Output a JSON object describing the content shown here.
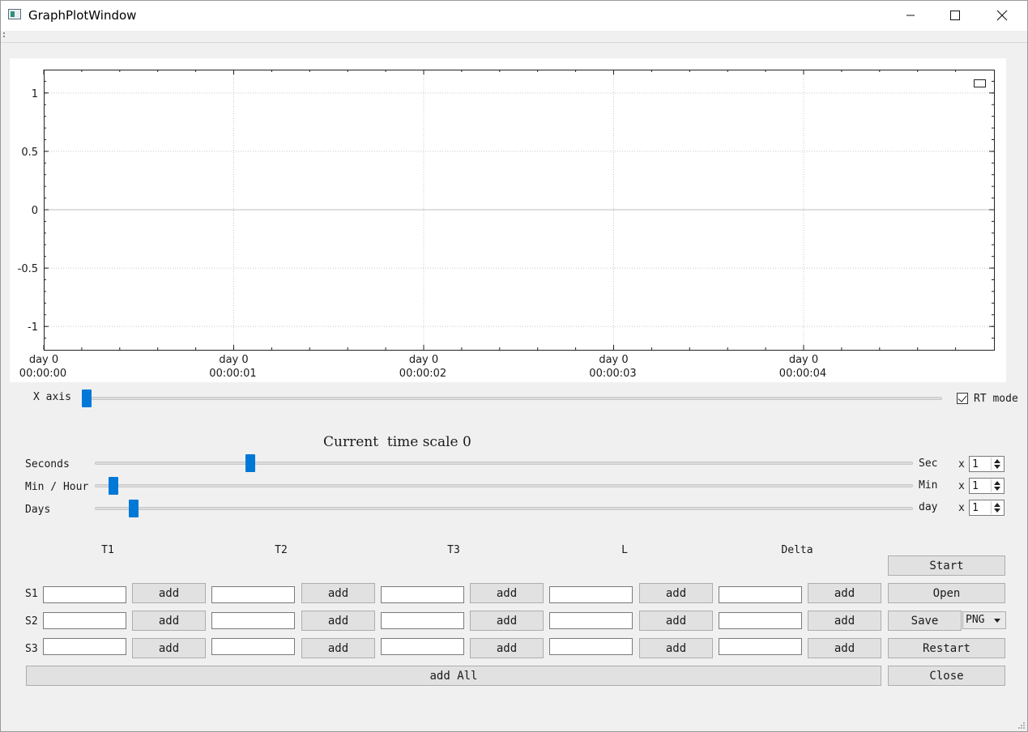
{
  "window": {
    "title": "GraphPlotWindow"
  },
  "chart_data": {
    "type": "line",
    "title": "",
    "xlabel": "",
    "ylabel": "",
    "x_tick_labels": [
      {
        "line1": "day 0",
        "line2": "00:00:00"
      },
      {
        "line1": "day 0",
        "line2": "00:00:01"
      },
      {
        "line1": "day 0",
        "line2": "00:00:02"
      },
      {
        "line1": "day 0",
        "line2": "00:00:03"
      },
      {
        "line1": "day 0",
        "line2": "00:00:04"
      }
    ],
    "y_tick_labels": [
      "1",
      "0.5",
      "0",
      "-0.5",
      "-1"
    ],
    "ylim": [
      -1.2,
      1.2
    ],
    "grid": true,
    "legend": "top-right",
    "series": []
  },
  "xaxis_slider": {
    "label": "X axis",
    "value": 0
  },
  "rt_mode": {
    "label": "RT mode",
    "checked": true
  },
  "time_scale": {
    "text": "Current  time scale",
    "value": "0"
  },
  "sliders": [
    {
      "label": "Seconds",
      "unit": "Sec",
      "mult_label": "x",
      "mult_value": "1",
      "fraction": 0.19
    },
    {
      "label": "Min / Hour",
      "unit": "Min",
      "mult_label": "x",
      "mult_value": "1",
      "fraction": 0.02
    },
    {
      "label": "Days",
      "unit": "day",
      "mult_label": "x",
      "mult_value": "1",
      "fraction": 0.045
    }
  ],
  "columns": [
    "T1",
    "T2",
    "T3",
    "L",
    "Delta"
  ],
  "rows": [
    "S1",
    "S2",
    "S3"
  ],
  "add_label": "add",
  "add_all_label": "add All",
  "actions": {
    "start": "Start",
    "open": "Open",
    "save": "Save",
    "format": "PNG",
    "restart": "Restart",
    "close": "Close"
  },
  "colors": {
    "accent": "#0078d7",
    "plot_bg": "#ffffff",
    "window_bg": "#f0f0f0"
  }
}
